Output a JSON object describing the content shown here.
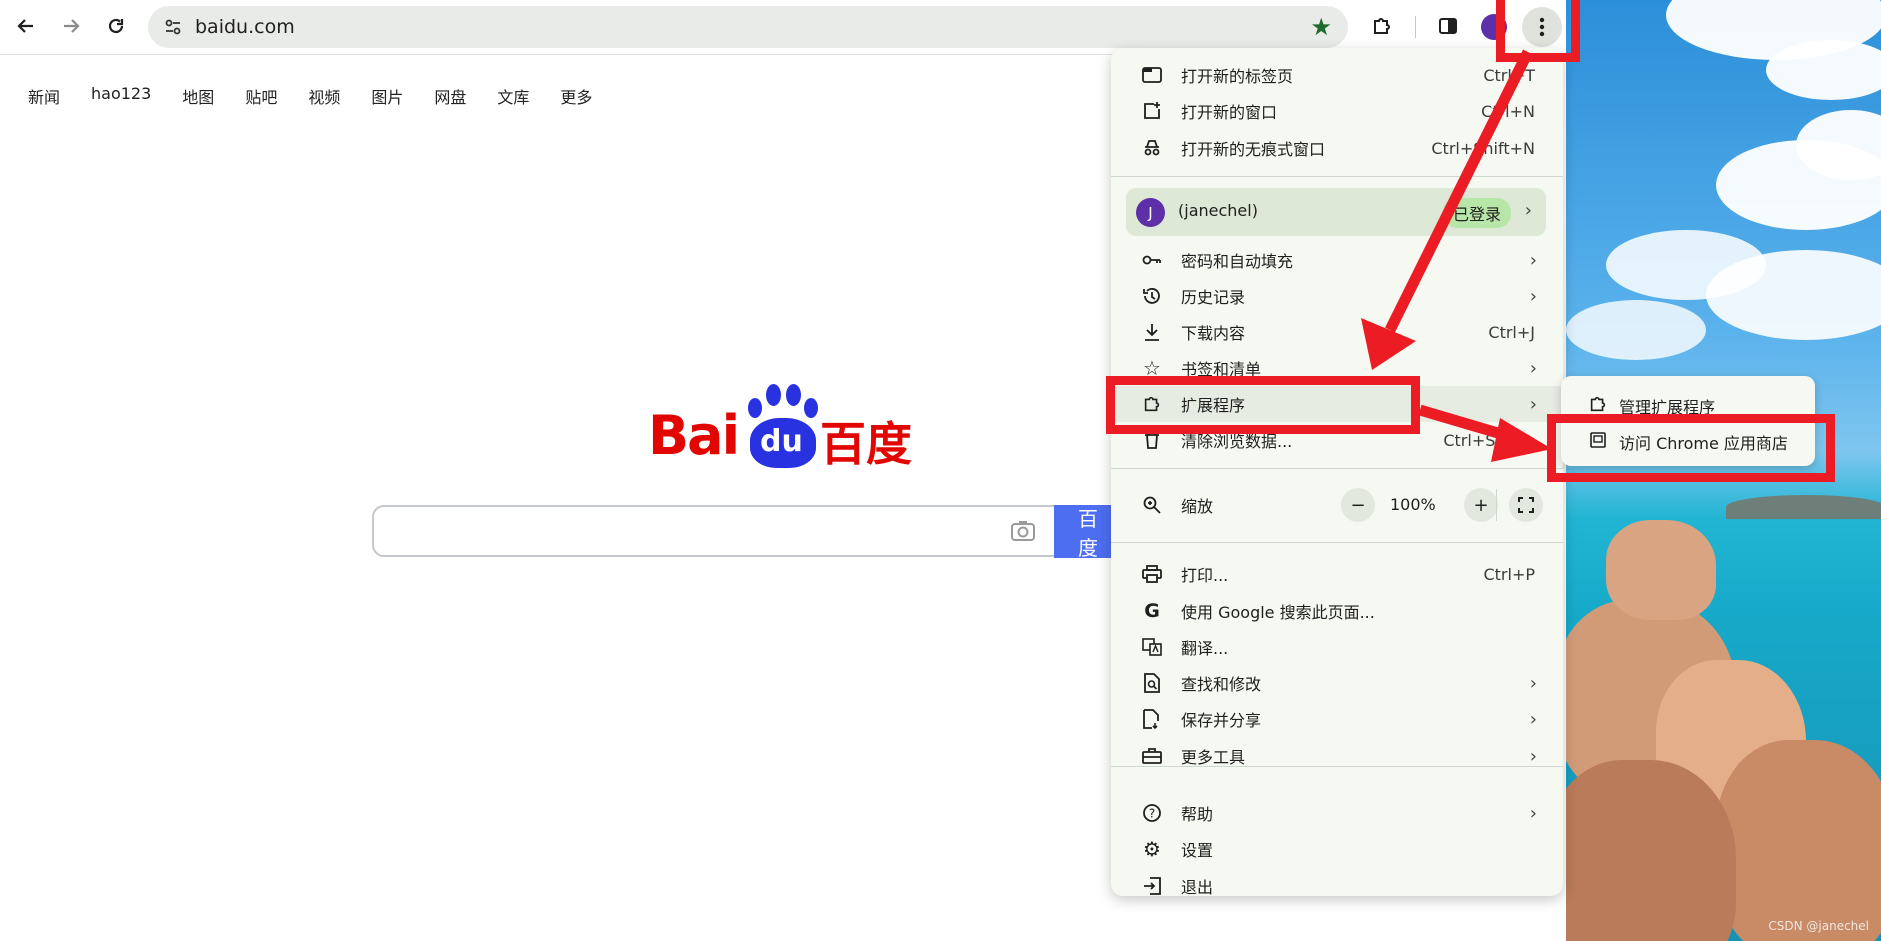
{
  "browser": {
    "url": "baidu.com",
    "nav_back_icon": "arrow-left-icon",
    "nav_forward_icon": "arrow-right-icon",
    "reload_icon": "reload-icon"
  },
  "baidu": {
    "nav_links": [
      "新闻",
      "hao123",
      "地图",
      "贴吧",
      "视频",
      "图片",
      "网盘",
      "文库",
      "更多"
    ],
    "logo_latin": "Bai",
    "logo_du": "du",
    "logo_cn": "百度",
    "search_button": "百度"
  },
  "menu": {
    "items_top": [
      {
        "label": "打开新的标签页",
        "shortcut": "Ctrl+T",
        "icon": "new-tab-icon"
      },
      {
        "label": "打开新的窗口",
        "shortcut": "Ctrl+N",
        "icon": "new-window-icon"
      },
      {
        "label": "打开新的无痕式窗口",
        "shortcut": "Ctrl+Shift+N",
        "icon": "incognito-icon"
      }
    ],
    "profile": {
      "avatar_letter": "J",
      "name": "(janechel)",
      "badge": "已登录"
    },
    "items_mid": [
      {
        "label": "密码和自动填充",
        "shortcut": "",
        "icon": "key-icon",
        "submenu": true
      },
      {
        "label": "历史记录",
        "shortcut": "",
        "icon": "history-icon",
        "submenu": true
      },
      {
        "label": "下载内容",
        "shortcut": "Ctrl+J",
        "icon": "download-icon",
        "submenu": false
      },
      {
        "label": "书签和清单",
        "shortcut": "",
        "icon": "star-icon",
        "submenu": true
      },
      {
        "label": "扩展程序",
        "shortcut": "",
        "icon": "extension-icon",
        "submenu": true
      },
      {
        "label": "清除浏览数据...",
        "shortcut": "Ctrl+Shift+",
        "icon": "trash-icon",
        "submenu": false
      }
    ],
    "zoom": {
      "label": "缩放",
      "value": "100%",
      "minus": "−",
      "plus": "+"
    },
    "items_tools": [
      {
        "label": "打印...",
        "shortcut": "Ctrl+P",
        "icon": "print-icon",
        "submenu": false
      },
      {
        "label": "使用 Google 搜索此页面...",
        "shortcut": "",
        "icon": "google-icon",
        "submenu": false
      },
      {
        "label": "翻译...",
        "shortcut": "",
        "icon": "translate-icon",
        "submenu": false
      },
      {
        "label": "查找和修改",
        "shortcut": "",
        "icon": "find-icon",
        "submenu": true
      },
      {
        "label": "保存并分享",
        "shortcut": "",
        "icon": "save-share-icon",
        "submenu": true
      },
      {
        "label": "更多工具",
        "shortcut": "",
        "icon": "toolbox-icon",
        "submenu": true
      }
    ],
    "items_bottom": [
      {
        "label": "帮助",
        "shortcut": "",
        "icon": "help-icon",
        "submenu": true
      },
      {
        "label": "设置",
        "shortcut": "",
        "icon": "gear-icon",
        "submenu": false
      },
      {
        "label": "退出",
        "shortcut": "",
        "icon": "exit-icon",
        "submenu": false
      }
    ]
  },
  "submenu": {
    "items": [
      {
        "label": "管理扩展程序",
        "icon": "extension-icon"
      },
      {
        "label": "访问 Chrome 应用商店",
        "icon": "web-store-icon"
      }
    ]
  },
  "watermark": "CSDN @janechel",
  "colors": {
    "annotation_red": "#ec1c24",
    "baidu_red": "#e10601",
    "baidu_blue": "#2932e1"
  }
}
